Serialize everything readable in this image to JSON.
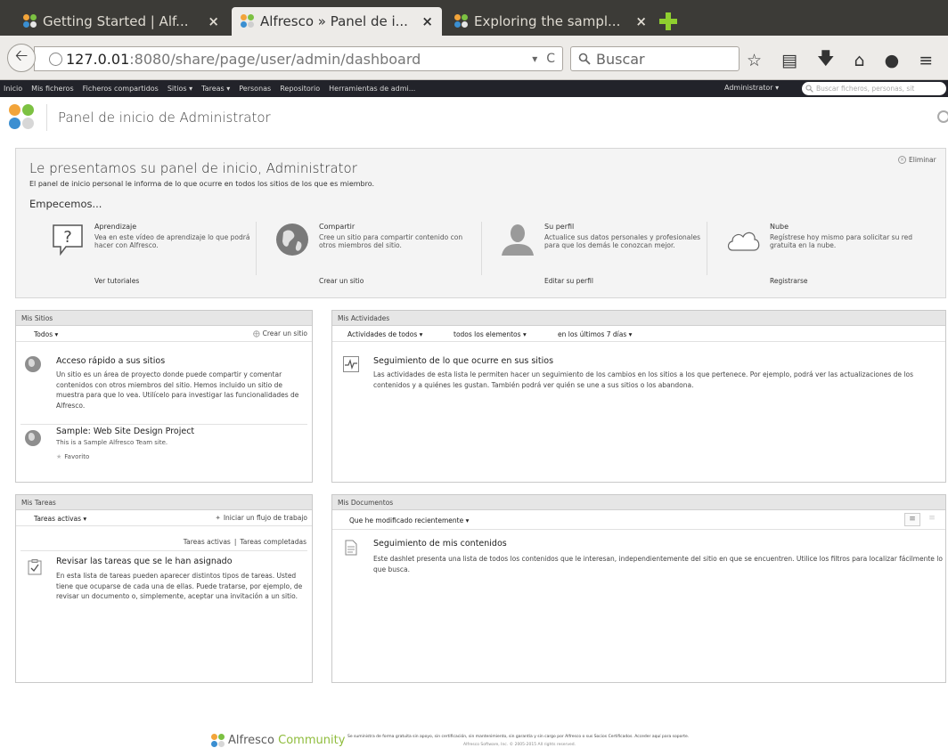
{
  "browser": {
    "tabs": [
      {
        "title": "Getting Started | Alf...",
        "close": "×",
        "active": false
      },
      {
        "title": "Alfresco » Panel de i...",
        "close": "×",
        "active": true
      },
      {
        "title": "Exploring the sampl...",
        "close": "×",
        "active": false
      }
    ],
    "new_tab_icon": "plus-icon",
    "url_host": "127.0.01",
    "url_path": ":8080/share/page/user/admin/dashboard",
    "url_dropdown": "▾",
    "url_reload": "C",
    "search_placeholder": "Buscar",
    "colors": {
      "tabstrip": "#3c3b37",
      "toolbar": "#edebe8",
      "new_tab": "#8fcf2f"
    }
  },
  "app_toolbar": {
    "items": [
      "Inicio",
      "Mis ficheros",
      "Ficheros compartidos",
      "Sitios ▾",
      "Tareas ▾",
      "Personas",
      "Repositorio",
      "Herramientas de admi..."
    ],
    "user_menu": "Administrator ▾",
    "search_placeholder": "Buscar ficheros, personas, sit",
    "colors": {
      "background": "#22232a"
    }
  },
  "header": {
    "title": "Panel de inicio de Administrator"
  },
  "welcome": {
    "title": "Le presentamos su panel de inicio, Administrator",
    "subtitle": "El panel de inicio personal le informa de lo que ocurre en todos los sitios de los que es miembro.",
    "start": "Empecemos...",
    "remove": "Eliminar",
    "columns": [
      {
        "icon": "question-speech-icon",
        "title": "Aprendizaje",
        "desc": "Vea en este vídeo de aprendizaje lo que podrá hacer con Alfresco.",
        "link": "Ver tutoriales"
      },
      {
        "icon": "globe-icon",
        "title": "Compartir",
        "desc": "Cree un sitio para compartir contenido con otros miembros del sitio.",
        "link": "Crear un sitio"
      },
      {
        "icon": "user-profile-icon",
        "title": "Su perfil",
        "desc": "Actualice sus datos personales y profesionales para que los demás le conozcan mejor.",
        "link": "Editar su perfil"
      },
      {
        "icon": "cloud-icon",
        "title": "Nube",
        "desc": "Regístrese hoy mismo para solicitar su red gratuita en la nube.",
        "link": "Registrarse"
      }
    ]
  },
  "my_sites": {
    "title": "Mis Sitios",
    "filter": "Todos ▾",
    "create": "Crear un sitio",
    "empty_title": "Acceso rápido a sus sitios",
    "empty_desc": "Un sitio es un área de proyecto donde puede compartir y comentar contenidos con otros miembros del sitio. Hemos incluido un sitio de muestra para que lo vea. Utilícelo para investigar las funcionalidades de Alfresco.",
    "site": {
      "name": "Sample: Web Site Design Project",
      "desc": "This is a Sample Alfresco Team site.",
      "favorite": "Favorito"
    }
  },
  "my_activities": {
    "title": "Mis Actividades",
    "filters": [
      "Actividades de todos ▾",
      "todos los elementos ▾",
      "en los últimos 7 días ▾"
    ],
    "empty_title": "Seguimiento de lo que ocurre en sus sitios",
    "empty_desc": "Las actividades de esta lista le permiten hacer un seguimiento de los cambios en los sitios a los que pertenece. Por ejemplo, podrá ver las actualizaciones de los contenidos y a quiénes les gustan. También podrá ver quién se une a sus sitios o los abandona."
  },
  "my_tasks": {
    "title": "Mis Tareas",
    "filter": "Tareas activas ▾",
    "start_workflow": "Iniciar un flujo de trabajo",
    "link_active": "Tareas activas",
    "link_sep": "|",
    "link_completed": "Tareas completadas",
    "empty_title": "Revisar las tareas que se le han asignado",
    "empty_desc": "En esta lista de tareas pueden aparecer distintos tipos de tareas. Usted tiene que ocuparse de cada una de ellas. Puede tratarse, por ejemplo, de revisar un documento o, simplemente, aceptar una invitación a un sitio."
  },
  "my_documents": {
    "title": "Mis Documentos",
    "filter": "Que he modificado recientemente ▾",
    "empty_title": "Seguimiento de mis contenidos",
    "empty_desc": "Este dashlet presenta una lista de todos los contenidos que le interesan, independientemente del sitio en que se encuentren. Utilice los filtros para localizar fácilmente lo que busca."
  },
  "footer": {
    "brand": "Alfresco",
    "brand_accent": "Community",
    "text": "Se suministra de forma gratuita sin apoyo, sin certificación, sin mantenimiento, sin garantía y sin cargo por Alfresco o sus Socios Certificados. Acceder aquí para soporte.",
    "copyright": "Alfresco Software, Inc. © 2005-2015 All rights reserved."
  }
}
